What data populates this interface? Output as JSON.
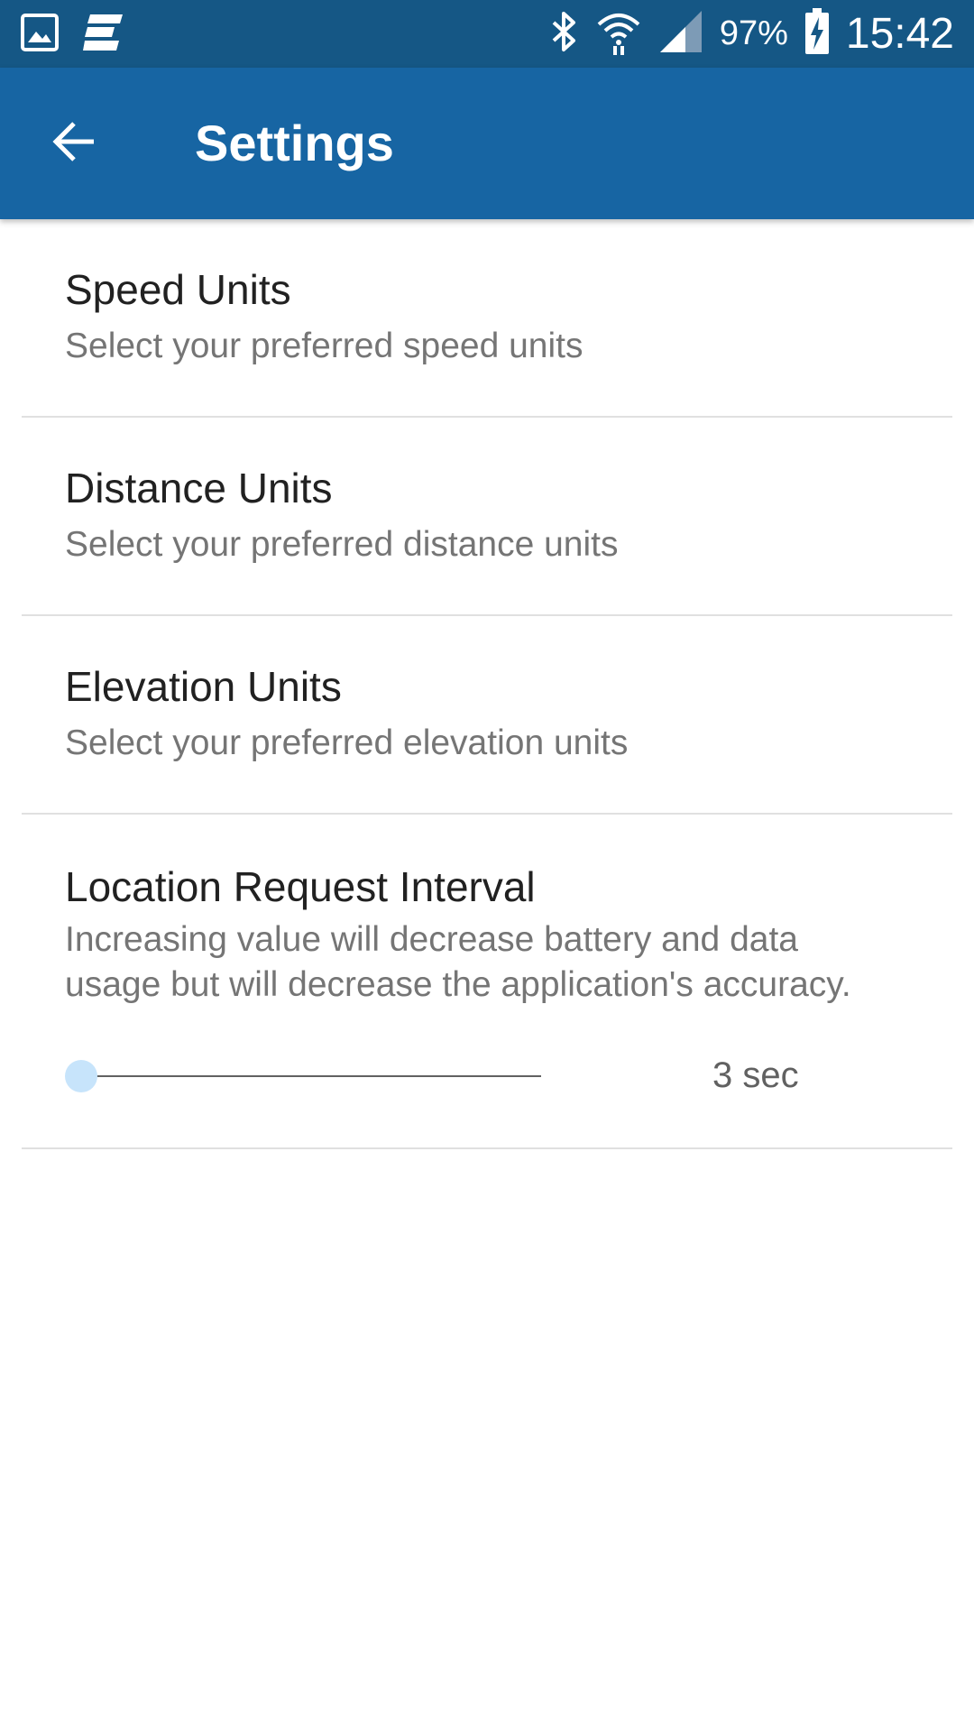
{
  "status_bar": {
    "battery_percent": "97%",
    "time": "15:42",
    "icons": [
      "gallery-icon",
      "app-notification-icon",
      "bluetooth-icon",
      "wifi-icon",
      "signal-icon",
      "battery-charging-icon"
    ]
  },
  "app_bar": {
    "back_icon": "arrow-back-icon",
    "title": "Settings"
  },
  "preferences": [
    {
      "title": "Speed Units",
      "summary": "Select your preferred speed units"
    },
    {
      "title": "Distance Units",
      "summary": "Select your preferred distance units"
    },
    {
      "title": "Elevation Units",
      "summary": "Select your preferred elevation units"
    }
  ],
  "interval": {
    "title": "Location Request Interval",
    "summary_line1": "Increasing value will decrease battery and data",
    "summary_line2": "usage but will decrease the application's accuracy.",
    "value_label": "3 sec",
    "slider_fraction": 0.0
  },
  "colors": {
    "status_bar": "#155785",
    "app_bar": "#1765a3",
    "slider_thumb": "#c7e4fb",
    "slider_track": "#616161"
  }
}
